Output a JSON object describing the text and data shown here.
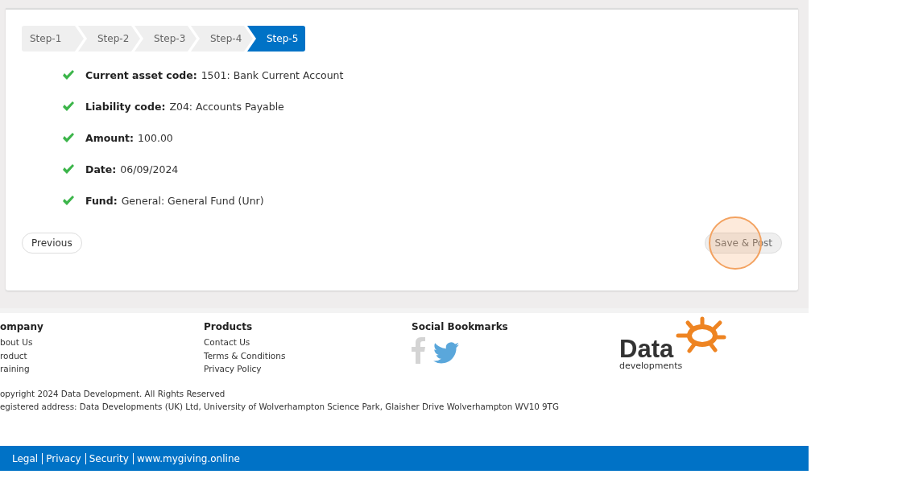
{
  "wizard": {
    "steps": [
      {
        "label": "Step-1",
        "selected": false
      },
      {
        "label": "Step-2",
        "selected": false
      },
      {
        "label": "Step-3",
        "selected": false
      },
      {
        "label": "Step-4",
        "selected": false
      },
      {
        "label": "Step-5",
        "selected": true
      }
    ],
    "summary": [
      {
        "label": "Current asset code:",
        "value": "1501: Bank Current Account",
        "valid": true
      },
      {
        "label": "Liability code:",
        "value": "Z04: Accounts Payable",
        "valid": true
      },
      {
        "label": "Amount:",
        "value": "100.00",
        "valid": true
      },
      {
        "label": "Date:",
        "value": "06/09/2024",
        "valid": true
      },
      {
        "label": "Fund:",
        "value": "General: General Fund (Unr)",
        "valid": true
      }
    ],
    "previous_button": {
      "label": "Previous"
    },
    "save_button": {
      "label": "Save & Post",
      "disabled": true
    }
  },
  "footer": {
    "columns": [
      {
        "heading": "ompany",
        "links": [
          "bout Us",
          "roduct",
          "raining"
        ]
      },
      {
        "heading": "Products",
        "links": [
          "Contact Us",
          "Terms & Conditions",
          "Privacy Policy"
        ]
      },
      {
        "heading": "Social Bookmarks"
      }
    ],
    "logo": {
      "name": "Data",
      "tagline": "developments"
    },
    "copyright": "opyright 2024 Data Development. All Rights Reserved",
    "address": "egistered address: Data Developments (UK) Ltd, University of Wolverhampton Science Park, Glaisher Drive Wolverhampton WV10 9TG",
    "bottom_links": [
      "Legal",
      "Privacy",
      "Security",
      "www.mygiving.online"
    ]
  }
}
